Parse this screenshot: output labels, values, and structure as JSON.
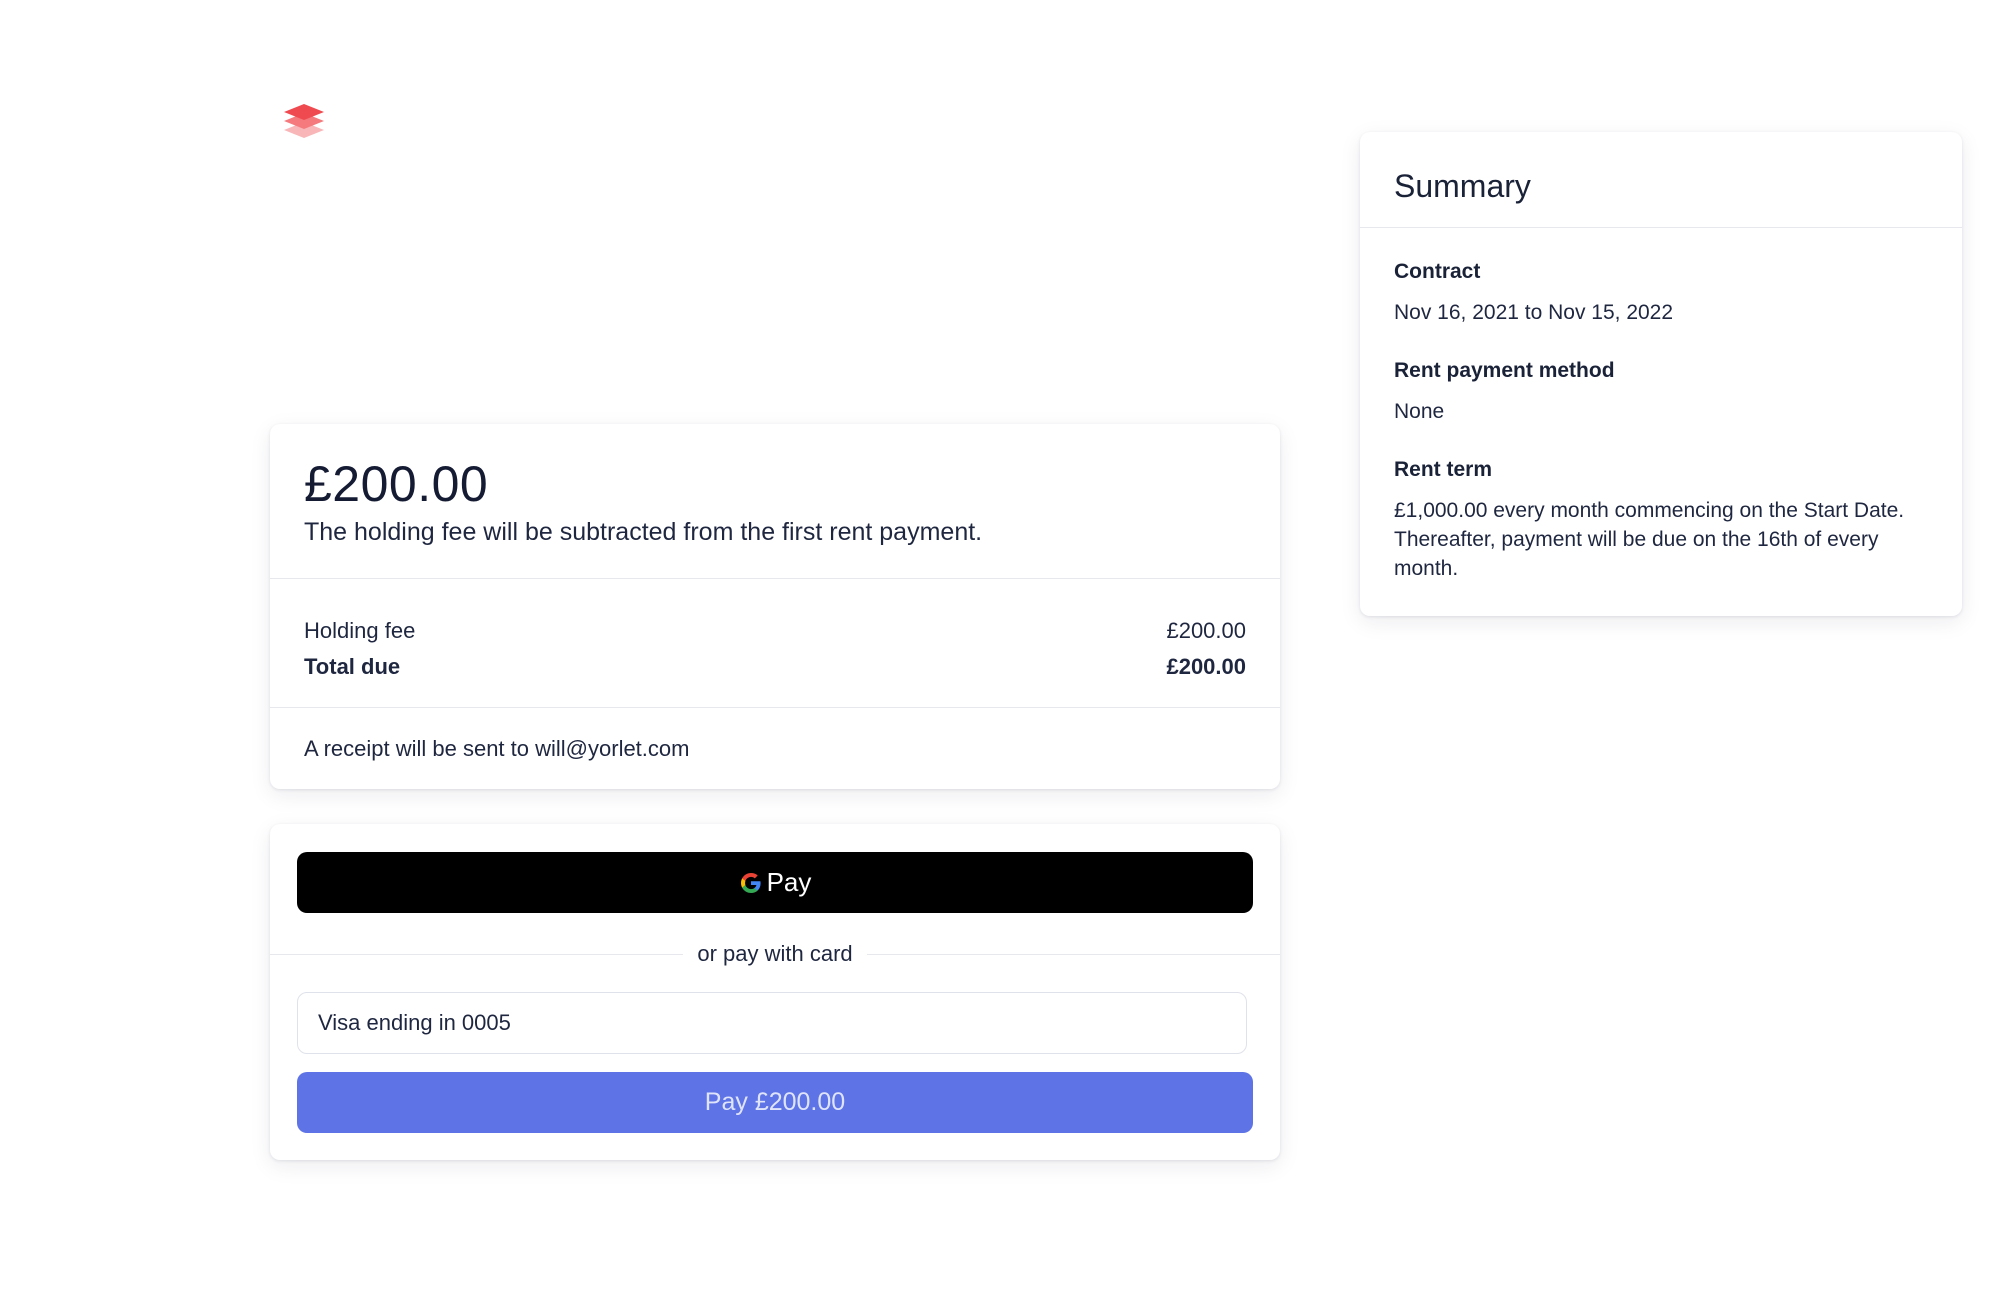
{
  "brand": {
    "logo_icon": "stacked-layers-icon",
    "logo_colors": [
      "#ef4a4f",
      "#f47a7d",
      "#f9b6b8"
    ]
  },
  "payment": {
    "amount": "£200.00",
    "description": "The holding fee will be subtracted from the first rent payment.",
    "line_items": [
      {
        "label": "Holding fee",
        "value": "£200.00"
      }
    ],
    "total": {
      "label": "Total due",
      "value": "£200.00"
    },
    "receipt_text": "A receipt will be sent to will@yorlet.com"
  },
  "checkout": {
    "gpay_label": "Pay",
    "gpay_icon": "google-g-icon",
    "divider_text": "or pay with card",
    "card_selected": "Visa ending in 0005",
    "pay_button_label": "Pay £200.00",
    "pay_button_color": "#5e73e6"
  },
  "summary": {
    "title": "Summary",
    "contract_label": "Contract",
    "contract_value": "Nov 16, 2021 to Nov 15, 2022",
    "method_label": "Rent payment method",
    "method_value": "None",
    "term_label": "Rent term",
    "term_value": "£1,000.00 every month commencing on the Start Date. Thereafter, payment will be due on the 16th of every month."
  }
}
